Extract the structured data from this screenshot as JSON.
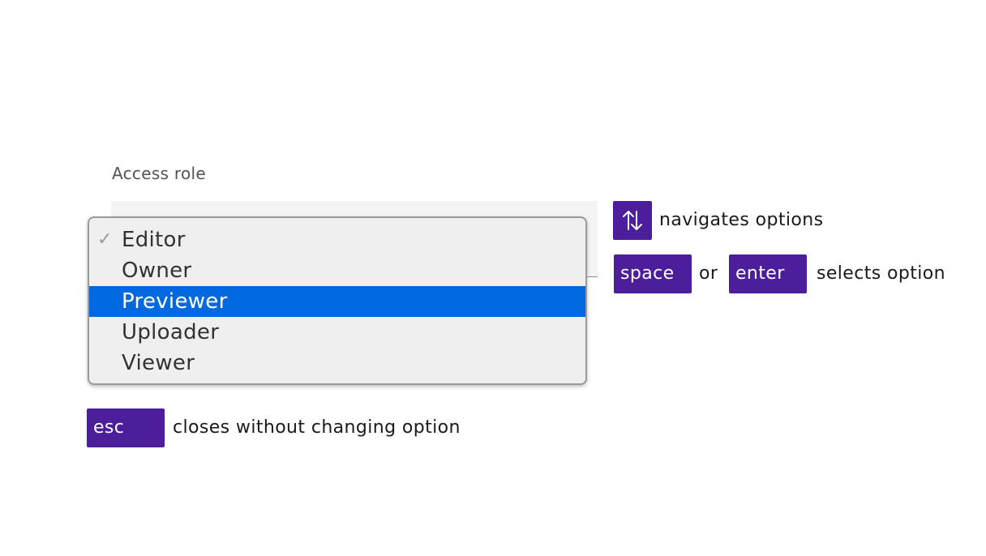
{
  "field": {
    "label": "Access role"
  },
  "listbox": {
    "options": [
      {
        "label": "Editor",
        "selected": true
      },
      {
        "label": "Owner"
      },
      {
        "label": "Previewer",
        "highlighted": true
      },
      {
        "label": "Uploader"
      },
      {
        "label": "Viewer"
      }
    ],
    "check_glyph": "✓"
  },
  "legend": {
    "arrows_icon": "up-down-arrows-icon",
    "navigate_text": "navigates options",
    "space_key": "space",
    "or_text": "or",
    "enter_key": "enter",
    "select_text": "selects option",
    "esc_key": "esc",
    "esc_text": "closes without changing option"
  },
  "colors": {
    "key_background": "#4d1e9c",
    "highlight": "#0069e0",
    "listbox_background": "#efefef"
  }
}
